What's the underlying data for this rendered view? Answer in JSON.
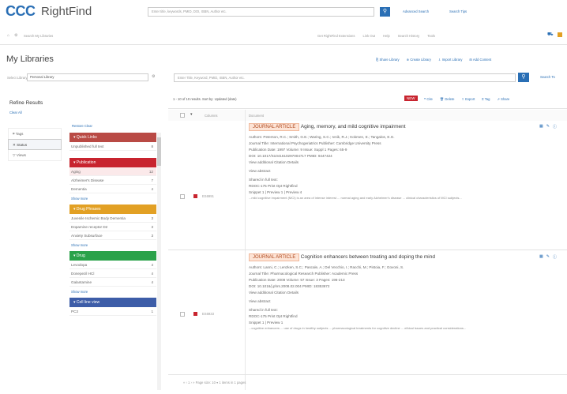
{
  "brand": {
    "logo": "CCC",
    "product": "RightFind"
  },
  "top": {
    "search_placeholder": "Enter title, keywords, PMID, DOI, ISBN, Author etc.",
    "advanced_search": "Advanced Search",
    "search_tips": "Search Tips",
    "row2_left": "Search My Libraries",
    "row2_links": [
      "Get RightFind Extensions",
      "Link Out",
      "Help",
      "Search History",
      "Tools"
    ]
  },
  "page_title": "My Libraries",
  "toolbar": {
    "links": [
      "Share Library",
      "Create Library",
      "Import Library",
      "Add Content"
    ],
    "select_library_label": "Select Library",
    "select_library_value": "Personal Library",
    "lib_search_placeholder": "Enter Title, Keyword, PMID, ISBN, Author etc.",
    "search_label": "Search To"
  },
  "refine": {
    "title": "Refine Results",
    "clear": "Clear All",
    "tabs": [
      "Tags",
      "Status",
      "Views"
    ],
    "reset": "Restore Clear",
    "facets": [
      {
        "title": "Quick Links",
        "color": "#b94a45",
        "rows": [
          [
            "Unpublished full text",
            "8"
          ]
        ]
      },
      {
        "title": "Publication",
        "color": "#c8242f",
        "rows": [
          [
            "Aging",
            "12"
          ],
          [
            "Alzheimer's Disease",
            "7"
          ],
          [
            "Dementia",
            "4"
          ]
        ],
        "more": "Show more"
      },
      {
        "title": "Drug Phrases",
        "color": "#e2a024",
        "rows": [
          [
            "Juvenile Ischemic Body Dementia",
            "3"
          ],
          [
            "Dopamine receptor D2",
            "3"
          ],
          [
            "Anxiety Subsurface",
            "3"
          ]
        ],
        "more": "Show more"
      },
      {
        "title": "Drug",
        "color": "#2aa24a",
        "rows": [
          [
            "Levodopa",
            "4"
          ],
          [
            "Donepezil HCl",
            "4"
          ],
          [
            "Galantamine",
            "4"
          ]
        ],
        "more": "Show more"
      },
      {
        "title": "Cell line view",
        "color": "#3d5da8",
        "rows": [
          [
            "PC3",
            "1"
          ]
        ]
      }
    ]
  },
  "results": {
    "count_text": "1 - 10 of 10 results. Sort by: Updated (date)",
    "alert_label": "NEW",
    "actions": [
      "Cite",
      "Delete",
      "Export",
      "Tag",
      "Share"
    ],
    "columns": [
      "Columns",
      "Document"
    ],
    "items": [
      {
        "badge": "JOURNAL ARTICLE",
        "title": "Aging, memory, and mild cognitive impairment",
        "authors": "Authors: Peterson, R.C.; Smith, G.E.; Waring, S.C.; Ivnik, R.J.; Kokmen, E.; Tangalos, E.G.",
        "journal": "Journal Title: International Psychogeriatrics   Publisher: Cambridge University Press",
        "pub": "Publication Date: 1997   Volume: 9   Issue: Suppl 1   Pages: 65-9",
        "doi": "DOI: 10.1017/S1041610297004717   PMID: 9447424",
        "cited": "View additional Citation Details",
        "view_text": "View abstract",
        "ft_label": "Shared in full text:",
        "ft_link": "RDOC-175   Print Opt Rightfind",
        "snippet_head": "Snippet 1 | Preview 1 | Preview 4",
        "snippet": "...mild cognitive impairment (MCI) is an area of intense interest ... normal aging and early Alzheimer's disease ... clinical characteristics of MCI subjects...",
        "ref_id": "ES6991",
        "dot_color": "#c8242f"
      },
      {
        "badge": "JOURNAL ARTICLE",
        "title": "Cognition enhancers between treating and doping the mind",
        "authors": "Authors: Lanni, C.; Lenzken, S.C.; Pascale, A.; Del Vecchio, I.; Racchi, M.; Pistoia, F.; Govoni, S.",
        "journal": "Journal Title: Pharmacological Research   Publisher: Academic Press",
        "pub": "Publication Date: 2008   Volume: 57   Issue: 3   Pages: 196-213",
        "doi": "DOI: 10.1016/j.phrs.2008.02.004   PMID: 18353672",
        "cited": "View additional Citation Details",
        "view_text": "View abstract",
        "ft_label": "Shared in full text:",
        "ft_link": "RDOC-175   Print Opt Rightfind",
        "snippet_head": "Snippet 1 | Preview 1",
        "snippet": "...cognitive enhancers ... use of drugs in healthy subjects ... pharmacological treatments for cognitive decline ... ethical issues and practical considerations...",
        "ref_id": "ES6933",
        "dot_color": "#c8242f"
      }
    ]
  },
  "pagination": {
    "text": "« ‹ 1 › »   Page size: 10 ▾   1 items in 1 pages"
  }
}
